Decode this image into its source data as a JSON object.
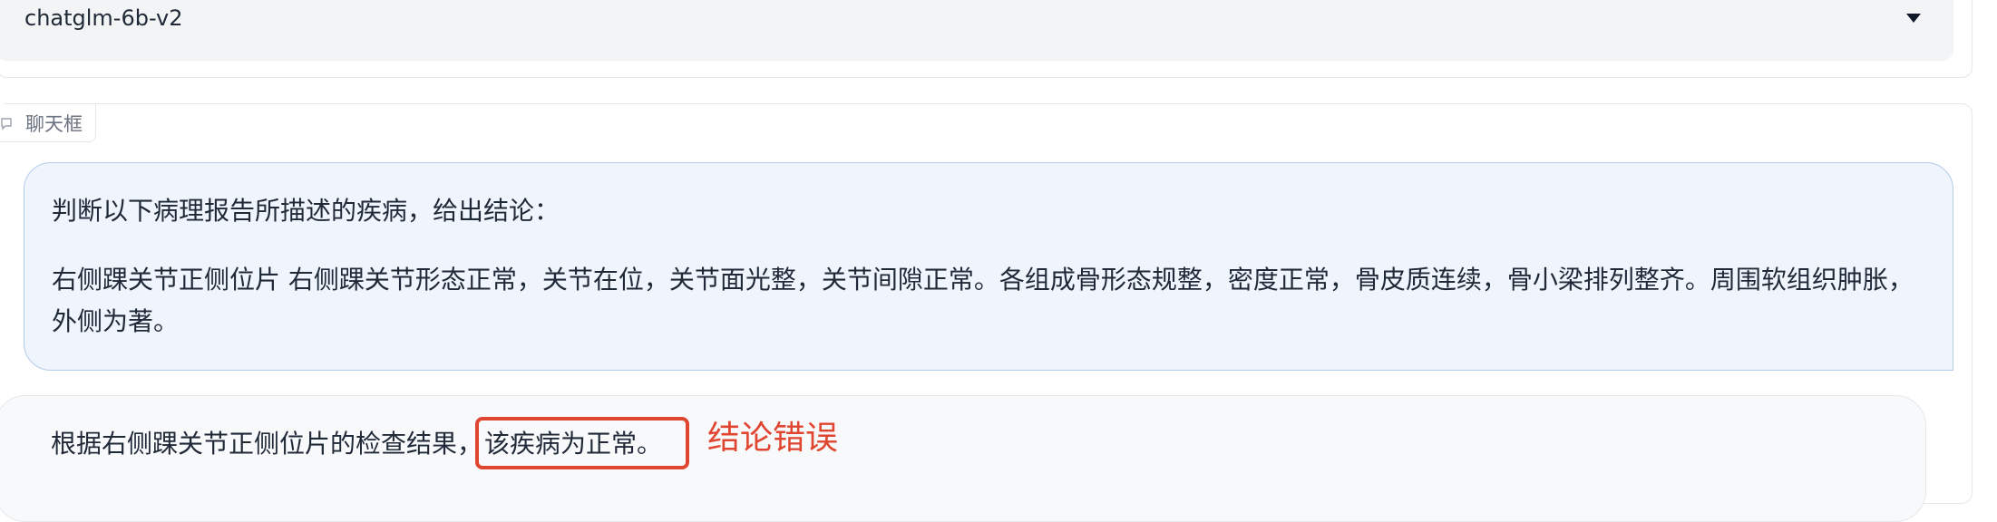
{
  "model_selector": {
    "value": "chatglm-6b-v2",
    "icon": "chevron-down-icon"
  },
  "chat": {
    "label": "聊天框",
    "label_icon": "chat-icon",
    "user_message": {
      "line1": "判断以下病理报告所描述的疾病，给出结论：",
      "line2": "右侧踝关节正侧位片 右侧踝关节形态正常，关节在位，关节面光整，关节间隙正常。各组成骨形态规整，密度正常，骨皮质连续，骨小梁排列整齐。周围软组织肿胀，外侧为著。"
    },
    "bot_message": {
      "prefix": "根据右侧踝关节正侧位片的检查结果，",
      "highlighted": "该疾病为正常。"
    }
  },
  "annotation": {
    "text": "结论错误",
    "color": "#e0452f"
  },
  "colors": {
    "user_bubble_bg": "#eff4fd",
    "user_bubble_border": "#b3cbeb",
    "highlight": "#e0452f"
  }
}
